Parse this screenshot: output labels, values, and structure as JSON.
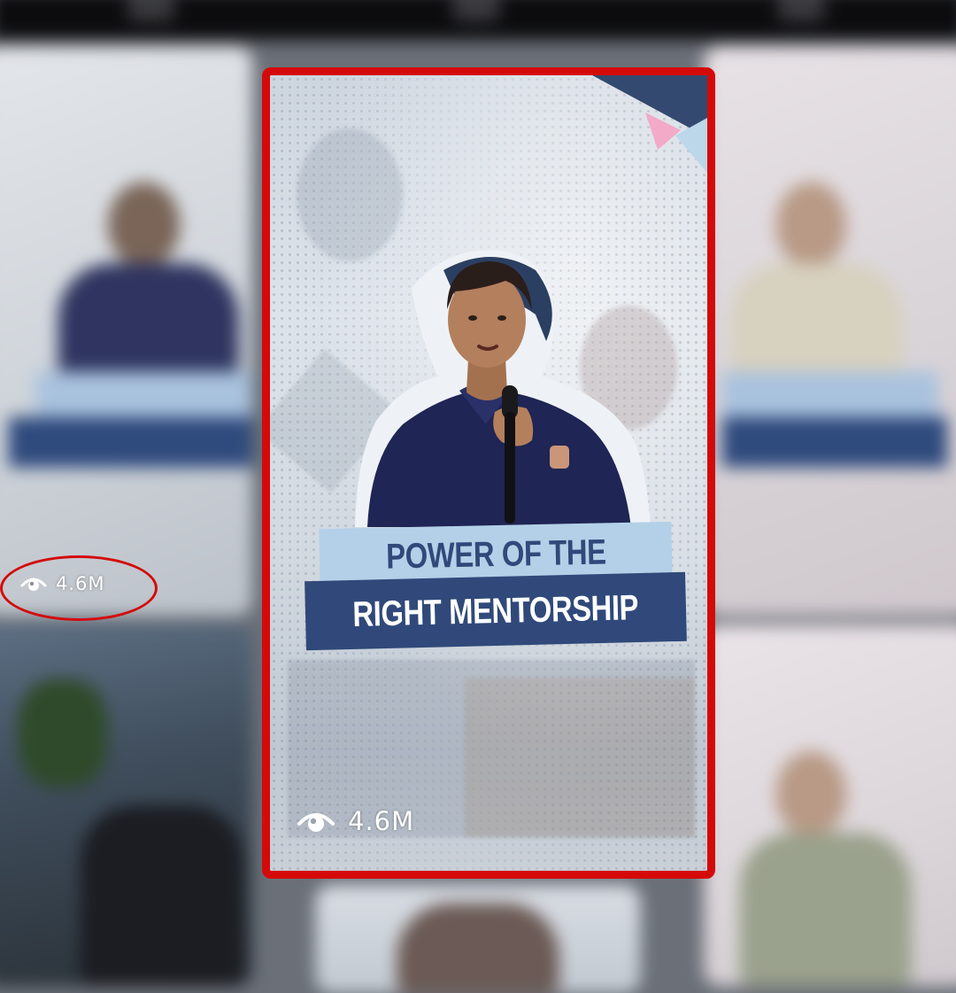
{
  "feed": {
    "tiles": [
      {
        "id": "left-top"
      },
      {
        "id": "right-top"
      },
      {
        "id": "left-bottom"
      },
      {
        "id": "center-bottom"
      },
      {
        "id": "right-bottom"
      }
    ]
  },
  "highlighted_card": {
    "title_line1": "POWER OF THE",
    "title_line2": "RIGHT MENTORSHIP",
    "view_count": "4.6M",
    "view_icon": "eye-icon",
    "border_color": "#d40a0a"
  },
  "side_card": {
    "view_count": "4.6M",
    "view_icon": "eye-icon",
    "highlight_color": "#d40a0a"
  },
  "colors": {
    "band_dark": "#30497a",
    "band_light": "#b4d0e8",
    "accent_pink": "#f3a9c8"
  }
}
